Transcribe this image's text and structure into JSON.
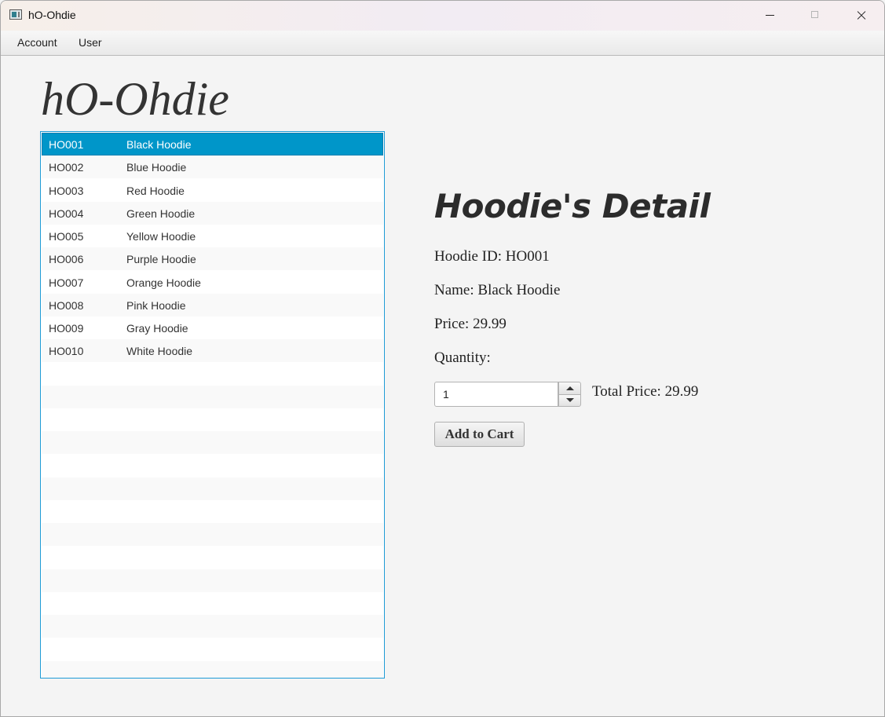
{
  "window": {
    "title": "hO-Ohdie"
  },
  "menu": {
    "items": [
      "Account",
      "User"
    ]
  },
  "app_heading": "hO-Ohdie",
  "hoodie_list": {
    "selected_index": 0,
    "rows": [
      {
        "id": "HO001",
        "name": "Black Hoodie"
      },
      {
        "id": "HO002",
        "name": "Blue Hoodie"
      },
      {
        "id": "HO003",
        "name": "Red Hoodie"
      },
      {
        "id": "HO004",
        "name": "Green Hoodie"
      },
      {
        "id": "HO005",
        "name": "Yellow Hoodie"
      },
      {
        "id": "HO006",
        "name": "Purple Hoodie"
      },
      {
        "id": "HO007",
        "name": "Orange Hoodie"
      },
      {
        "id": "HO008",
        "name": "Pink Hoodie"
      },
      {
        "id": "HO009",
        "name": "Gray Hoodie"
      },
      {
        "id": "HO010",
        "name": "White Hoodie"
      }
    ]
  },
  "detail": {
    "title": "Hoodie's Detail",
    "id_label": "Hoodie ID: HO001",
    "name_label": "Name: Black Hoodie",
    "price_label": "Price: 29.99",
    "quantity_label": "Quantity:",
    "quantity_value": "1",
    "total_label": "Total Price: 29.99",
    "add_button": "Add to Cart"
  },
  "colors": {
    "selection": "#0096c9",
    "list_border": "#1e9bd6",
    "background": "#f4f4f4"
  },
  "icons": {
    "app": "app-window-icon",
    "minimize": "minimize-icon",
    "maximize": "maximize-icon",
    "close": "close-icon"
  }
}
